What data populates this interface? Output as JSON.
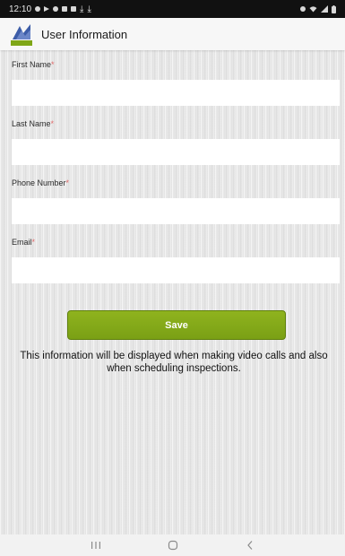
{
  "status_bar": {
    "time": "12:10",
    "left_icons": [
      "notification-icon",
      "play-icon",
      "cloud-icon",
      "image-icon",
      "lock-icon",
      "download-icon",
      "download-icon"
    ],
    "right_icons": [
      "alarm-icon",
      "wifi-icon",
      "signal-icon",
      "battery-icon"
    ]
  },
  "header": {
    "title": "User Information",
    "logo_icon": "app-logo-icon"
  },
  "form": {
    "required_marker": "*",
    "fields": [
      {
        "label": "First Name",
        "value": "",
        "placeholder": ""
      },
      {
        "label": "Last Name",
        "value": "",
        "placeholder": ""
      },
      {
        "label": "Phone Number",
        "value": "",
        "placeholder": ""
      },
      {
        "label": "Email",
        "value": "",
        "placeholder": ""
      }
    ],
    "save_label": "Save",
    "info_text": "This information will be displayed when making video calls and also when scheduling inspections."
  },
  "nav_bar": {
    "buttons": [
      "recent-apps-icon",
      "home-icon",
      "back-icon"
    ]
  },
  "colors": {
    "accent": "#7fa617",
    "status_bar": "#111111",
    "content_bg": "#e6e6e6",
    "required": "#e06a6a"
  }
}
